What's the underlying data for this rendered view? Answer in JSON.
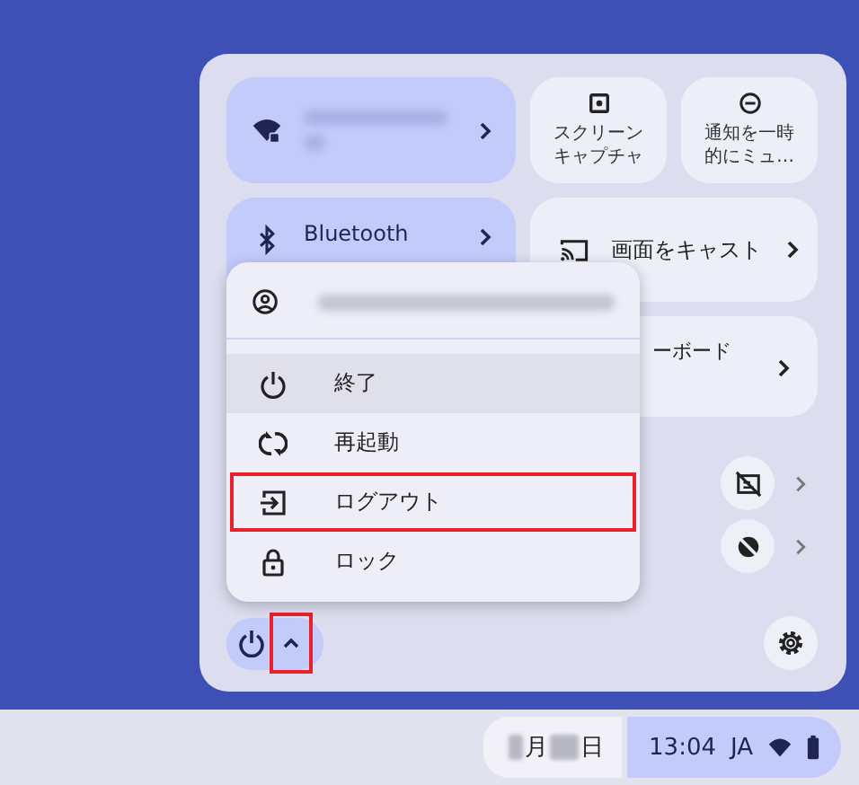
{
  "quick_settings": {
    "network_tile": {
      "on": true
    },
    "bluetooth_tile": {
      "label": "Bluetooth",
      "on": true
    },
    "small_tiles": [
      {
        "kind": "screenshot",
        "lines": [
          "スクリーン",
          "キャプチャ"
        ]
      },
      {
        "kind": "dnd",
        "lines": [
          "通知を一時",
          "的にミュ…"
        ]
      }
    ],
    "cast_tile": {
      "label": "画面をキャスト"
    },
    "keyboard_tile": {
      "label": "ーボード"
    },
    "feature_buttons": [
      {
        "kind": "screen-off"
      },
      {
        "kind": "circle-off"
      }
    ]
  },
  "power_menu": {
    "items": [
      {
        "kind": "power",
        "label": "終了",
        "hovered": true,
        "annotated": false
      },
      {
        "kind": "restart",
        "label": "再起動",
        "hovered": false,
        "annotated": false
      },
      {
        "kind": "logout",
        "label": "ログアウト",
        "hovered": false,
        "annotated": true
      },
      {
        "kind": "lock",
        "label": "ロック",
        "hovered": false,
        "annotated": false
      }
    ]
  },
  "power_button": {
    "chevron_annotated": true
  },
  "shelf": {
    "date_month": "月",
    "date_day": "日",
    "time": "13:04",
    "ime": "JA"
  }
}
